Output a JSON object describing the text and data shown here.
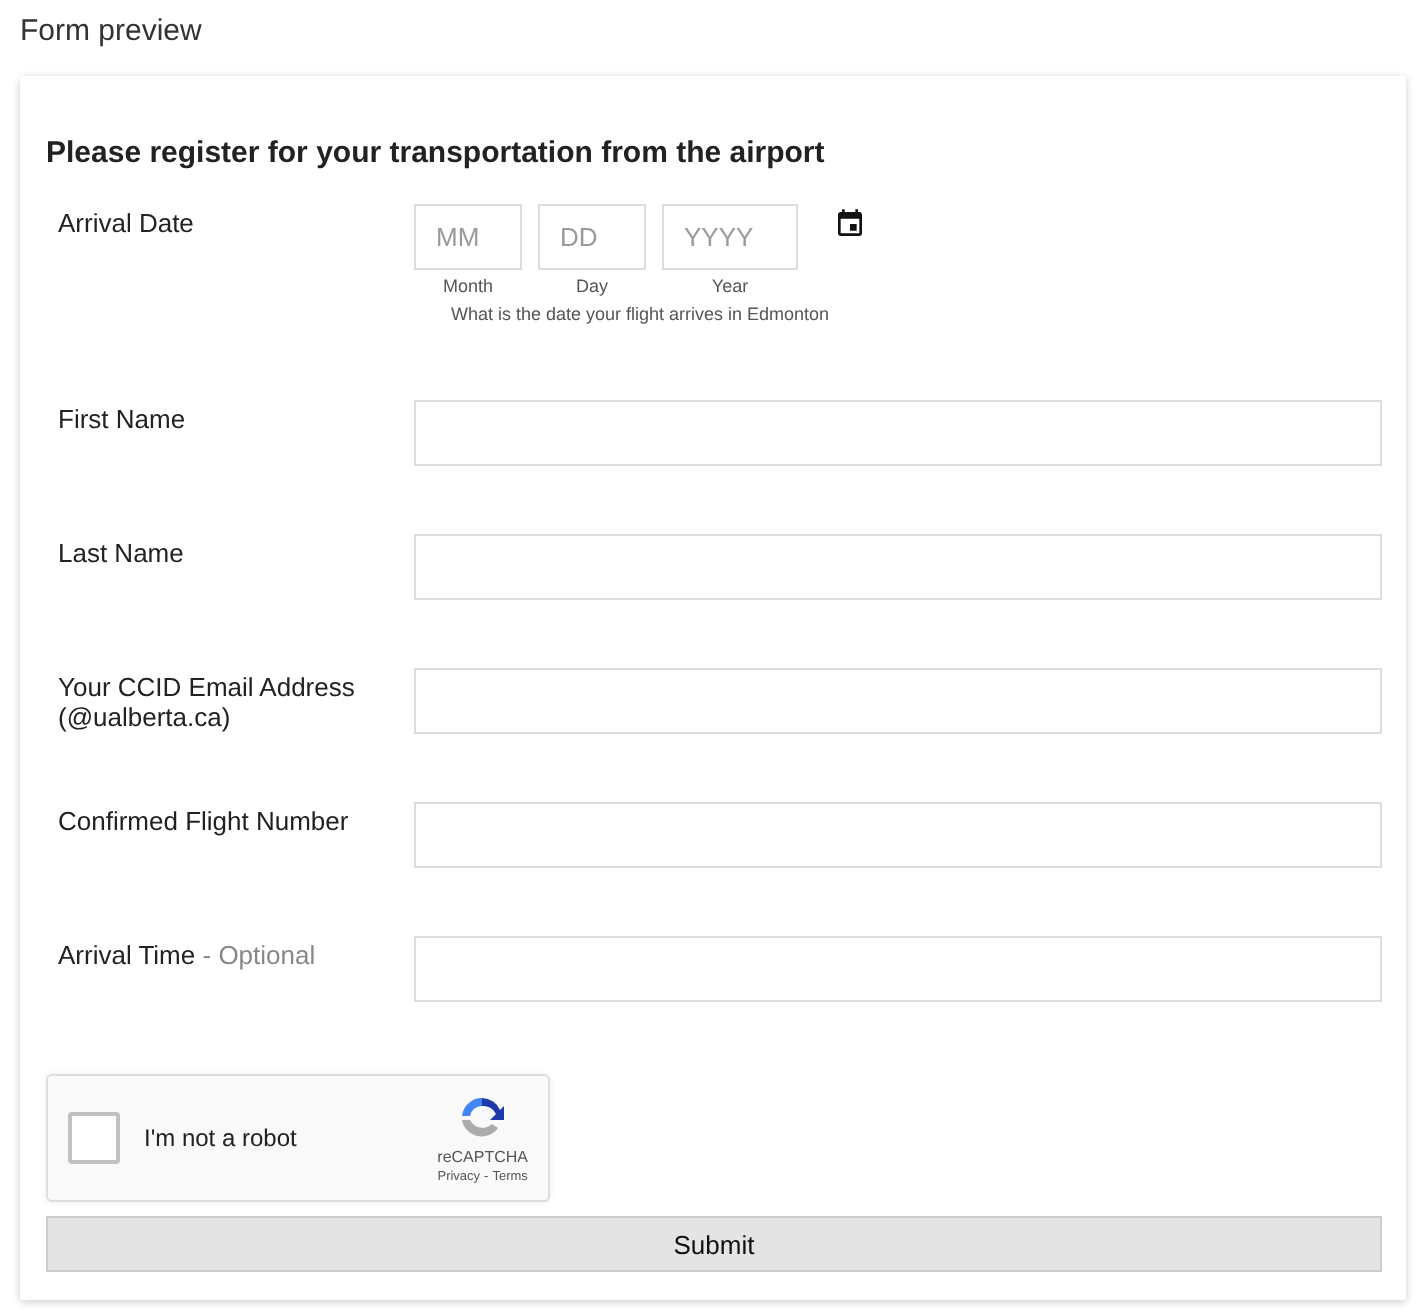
{
  "page_title": "Form preview",
  "form": {
    "heading": "Please register for your transportation from the airport",
    "date_field": {
      "label": "Arrival Date",
      "parts": [
        {
          "placeholder": "MM",
          "caption": "Month"
        },
        {
          "placeholder": "DD",
          "caption": "Day"
        },
        {
          "placeholder": "YYYY",
          "caption": "Year"
        }
      ],
      "help": "What is the date your flight arrives in Edmonton"
    },
    "fields": [
      {
        "label": "First Name"
      },
      {
        "label": "Last Name"
      },
      {
        "label": "Your CCID Email Address (@ualberta.ca)"
      },
      {
        "label": "Confirmed Flight Number"
      },
      {
        "label": "Arrival Time",
        "optional": "- Optional"
      }
    ],
    "captcha": {
      "label": "I'm not a robot",
      "checked": false,
      "brand": "reCAPTCHA",
      "links": [
        "Privacy",
        "Terms"
      ],
      "separator": "-"
    },
    "submit": "Submit"
  }
}
